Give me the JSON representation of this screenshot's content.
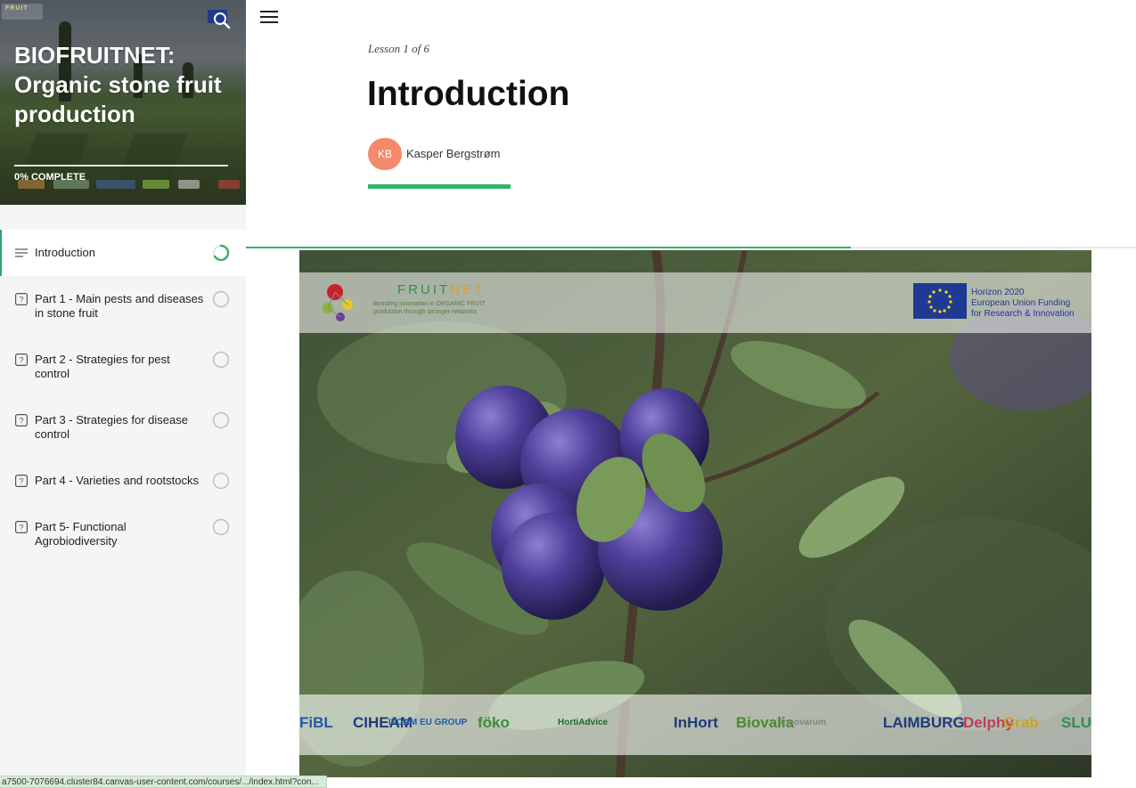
{
  "course": {
    "title": "BIOFRUITNET: Organic stone fruit production",
    "progress_label": "0% COMPLETE",
    "progress_fraction": 0.0
  },
  "sidebar": {
    "lessons": [
      {
        "label": "Introduction",
        "icon": "text-lines-icon",
        "status": "in-progress",
        "active": true
      },
      {
        "label": "Part 1 - Main pests and diseases in stone fruit",
        "icon": "quiz-icon",
        "status": "not-started",
        "active": false
      },
      {
        "label": "Part 2 - Strategies for pest control",
        "icon": "quiz-icon",
        "status": "not-started",
        "active": false
      },
      {
        "label": "Part 3 - Strategies for disease control",
        "icon": "quiz-icon",
        "status": "not-started",
        "active": false
      },
      {
        "label": "Part 4 - Varieties and rootstocks",
        "icon": "quiz-icon",
        "status": "not-started",
        "active": false
      },
      {
        "label": "Part 5- Functional Agrobiodiversity",
        "icon": "quiz-icon",
        "status": "not-started",
        "active": false
      }
    ]
  },
  "lesson": {
    "count_label": "Lesson 1 of 6",
    "title": "Introduction",
    "author_initials": "KB",
    "author_name": "Kasper Bergstrøm",
    "read_progress_fraction": 0.68
  },
  "media": {
    "brand_name": "FRUIT",
    "brand_suffix": "NET",
    "tagline": "Boosting innovation in ORGANIC FRUIT production through stronger networks",
    "eu_text_lines": [
      "Horizon 2020",
      "European Union Funding",
      "for Research & Innovation"
    ],
    "partner_logos": [
      "FiBL",
      "CIHEAM",
      "IFOAM EU GROUP",
      "föko",
      "HortiAdvice",
      "InHort",
      "Biovalia",
      "innovarum",
      "LAIMBURG",
      "Delphy",
      "Grab",
      "SLU"
    ]
  },
  "browser": {
    "status_url": "a7500-7076694.cluster84.canvas-user-content.com/courses/.../index.html?con..."
  },
  "colors": {
    "accent_green": "#2fb36a",
    "avatar_bg": "#f28a6b",
    "eu_blue": "#1f3a93"
  }
}
